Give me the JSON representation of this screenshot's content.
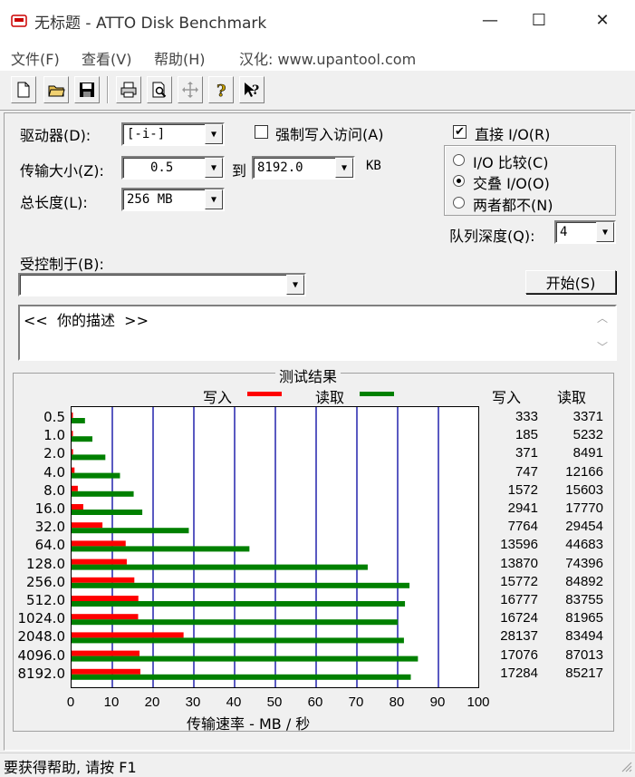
{
  "window": {
    "title": "无标题 - ATTO Disk Benchmark",
    "minimize_glyph": "—",
    "maximize_glyph": "☐",
    "close_glyph": "✕"
  },
  "menu": {
    "file": "文件(F)",
    "view": "查看(V)",
    "help": "帮助(H)",
    "credit": "汉化: www.upantool.com"
  },
  "toolbar": {
    "icons": [
      "new-file-icon",
      "open-folder-icon",
      "save-icon",
      "print-icon",
      "print-preview-icon",
      "move-icon",
      "help-icon",
      "context-help-icon"
    ]
  },
  "settings": {
    "drive_label": "驱动器(D):",
    "drive_value": "[-i-]",
    "transfer_label": "传输大小(Z):",
    "transfer_from": "0.5",
    "to_label": "到",
    "transfer_to": "8192.0",
    "kb_label": "KB",
    "length_label": "总长度(L):",
    "length_value": "256 MB",
    "force_write_label": "强制写入访问(A)",
    "force_write_checked": false,
    "direct_io_label": "直接 I/O(R)",
    "direct_io_checked": true,
    "io_compare_label": "I/O 比较(C)",
    "overlapped_io_label": "交叠 I/O(O)",
    "neither_label": "两者都不(N)",
    "selected_mode": "overlapped",
    "queue_depth_label": "队列深度(Q):",
    "queue_depth_value": "4",
    "controlled_by_label": "受控制于(B):",
    "controlled_by_value": "",
    "start_button": "开始(S)",
    "description": "<<  你的描述  >>"
  },
  "results": {
    "group_title": "测试结果",
    "legend_write": "写入",
    "legend_read": "读取",
    "col_write": "写入",
    "col_read": "读取",
    "x_axis_label": "传输速率 - MB / 秒",
    "x_ticks": [
      "0",
      "10",
      "20",
      "30",
      "40",
      "50",
      "60",
      "70",
      "80",
      "90",
      "100"
    ],
    "write_color": "#ff0000",
    "read_color": "#008000",
    "grid_color": "#0000a0"
  },
  "chart_data": {
    "type": "bar",
    "orientation": "horizontal",
    "categories": [
      "0.5",
      "1.0",
      "2.0",
      "4.0",
      "8.0",
      "16.0",
      "32.0",
      "64.0",
      "128.0",
      "256.0",
      "512.0",
      "1024.0",
      "2048.0",
      "4096.0",
      "8192.0"
    ],
    "series": [
      {
        "name": "写入",
        "values": [
          333,
          185,
          371,
          747,
          1572,
          2941,
          7764,
          13596,
          13870,
          15772,
          16777,
          16724,
          28137,
          17076,
          17284
        ]
      },
      {
        "name": "读取",
        "values": [
          3371,
          5232,
          8491,
          12166,
          15603,
          17770,
          29454,
          44683,
          74396,
          84892,
          83755,
          81965,
          83494,
          87013,
          85217
        ]
      }
    ],
    "xlabel": "传输速率 - MB / 秒",
    "xlim": [
      0,
      100
    ],
    "bar_unit_note": "values shown in KB/s",
    "grid": true
  },
  "status": {
    "text": "要获得帮助, 请按 F1"
  }
}
